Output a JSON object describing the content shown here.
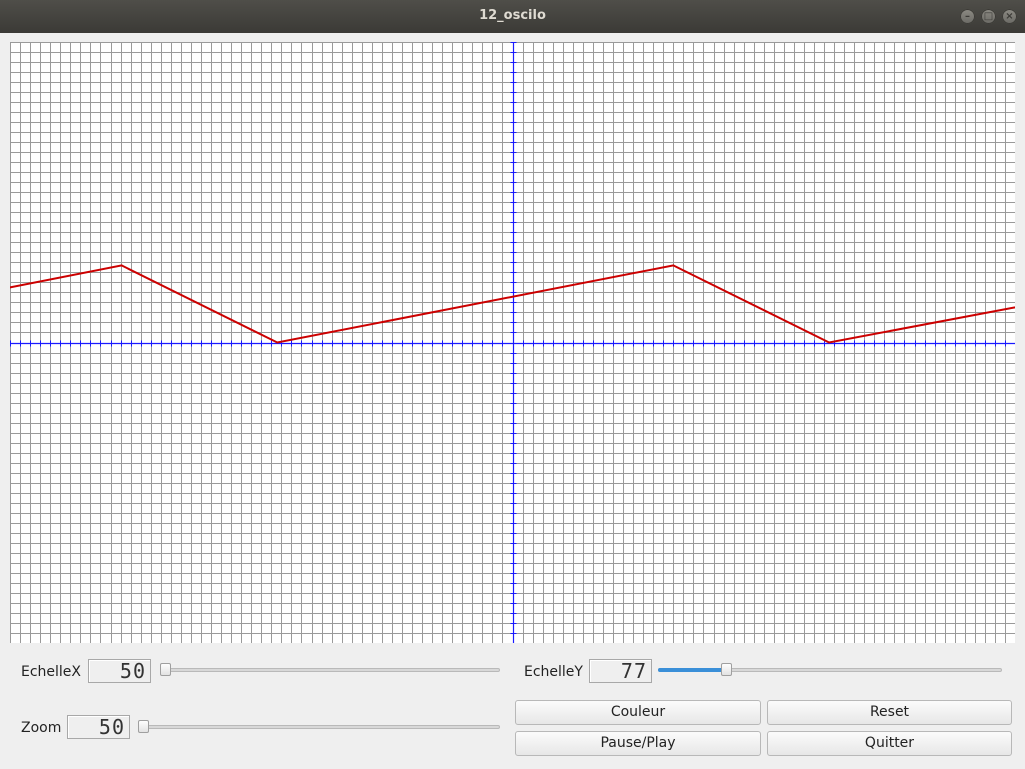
{
  "window": {
    "title": "12_oscilo"
  },
  "controls": {
    "echelle_x": {
      "label": "EchelleX",
      "value": "50"
    },
    "echelle_y": {
      "label": "EchelleY",
      "value": "77"
    },
    "zoom": {
      "label": "Zoom",
      "value": "50"
    }
  },
  "buttons": {
    "couleur": "Couleur",
    "reset": "Reset",
    "pause_play": "Pause/Play",
    "quitter": "Quitter"
  },
  "sliders": {
    "echelle_x_level": 0.0,
    "echelle_y_level": 0.19,
    "zoom_level": 0.0
  },
  "colors": {
    "grid": "#9a9a9a",
    "axes": "#1a1aff",
    "signal": "#cc0000"
  },
  "chart_data": {
    "type": "line",
    "grid": true,
    "xlim": [
      -500,
      500
    ],
    "ylim": [
      -300,
      300
    ],
    "series": [
      {
        "x": [
          -500,
          -389,
          -234,
          160,
          315,
          500
        ],
        "y": [
          55,
          77,
          0,
          77,
          0,
          35
        ]
      }
    ]
  }
}
